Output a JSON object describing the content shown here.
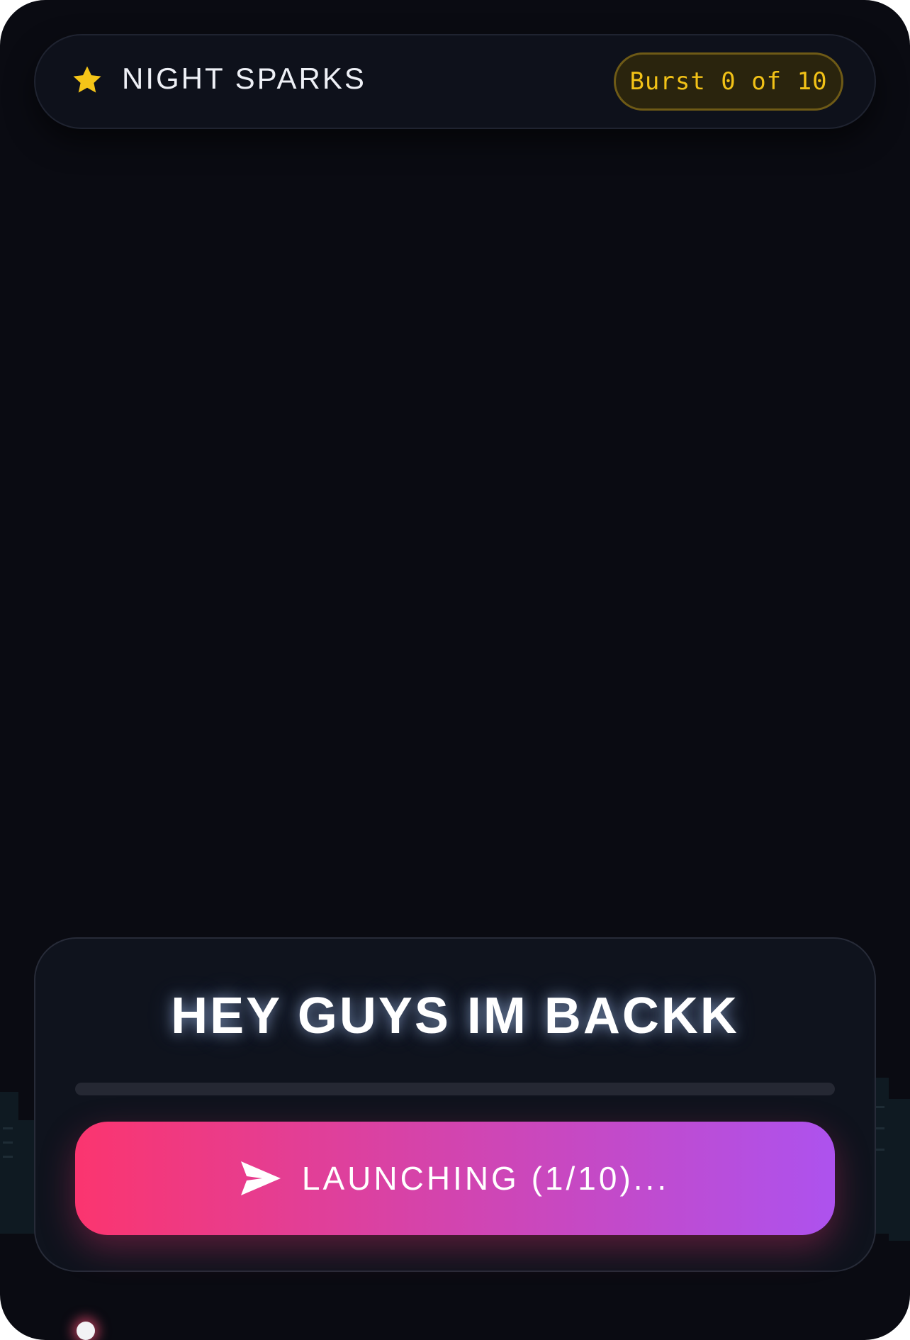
{
  "header": {
    "icon": "star-icon",
    "title": "NIGHT SPARKS",
    "badge": "Burst 0 of 10"
  },
  "card": {
    "message": "HEY GUYS IM BACKK",
    "progress": 0,
    "button_icon": "send-icon",
    "button_label": "LAUNCHING (1/10)..."
  },
  "colors": {
    "accent_gold": "#f2c217",
    "button_gradient_start": "#fb356f",
    "button_gradient_end": "#ad52ee",
    "background": "#0a0b12"
  }
}
